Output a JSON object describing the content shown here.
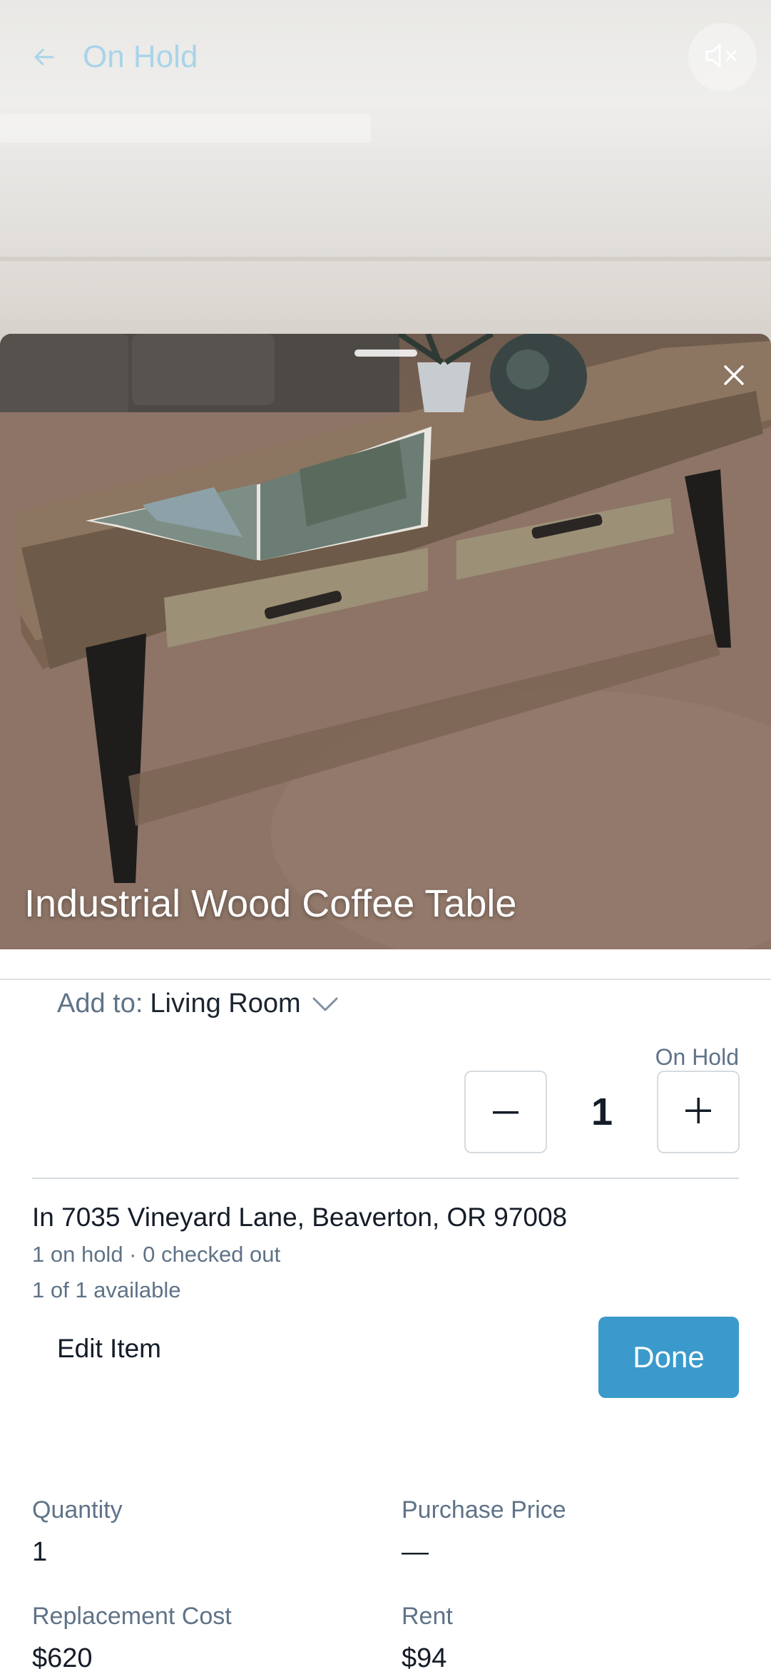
{
  "background_page": {
    "title": "On Hold"
  },
  "sheet": {
    "item_title": "Industrial Wood Coffee Table",
    "add_to": {
      "label": "Add to:",
      "value": "Living Room"
    },
    "status": "On Hold",
    "stepper": {
      "minus": "–",
      "value": "1",
      "plus": "+"
    },
    "location": "In 7035 Vineyard Lane, Beaverton, OR 97008",
    "meta_hold": "1 on hold · 0 checked out",
    "meta_available": "1 of 1 available",
    "edit_label": "Edit Item",
    "done_label": "Done"
  },
  "details": {
    "quantity_label": "Quantity",
    "quantity_value": "1",
    "purchase_price_label": "Purchase Price",
    "purchase_price_value": "—",
    "replacement_cost_label": "Replacement Cost",
    "replacement_cost_value": "$620",
    "rent_label": "Rent",
    "rent_value": "$94"
  },
  "colors": {
    "accent": "#3b9acb",
    "muted_text": "#5f7388",
    "header_title": "#a9d4ea"
  },
  "icons": [
    "back-arrow-icon",
    "mute-icon",
    "close-icon",
    "chevron-down-icon",
    "minus-icon",
    "plus-icon"
  ]
}
